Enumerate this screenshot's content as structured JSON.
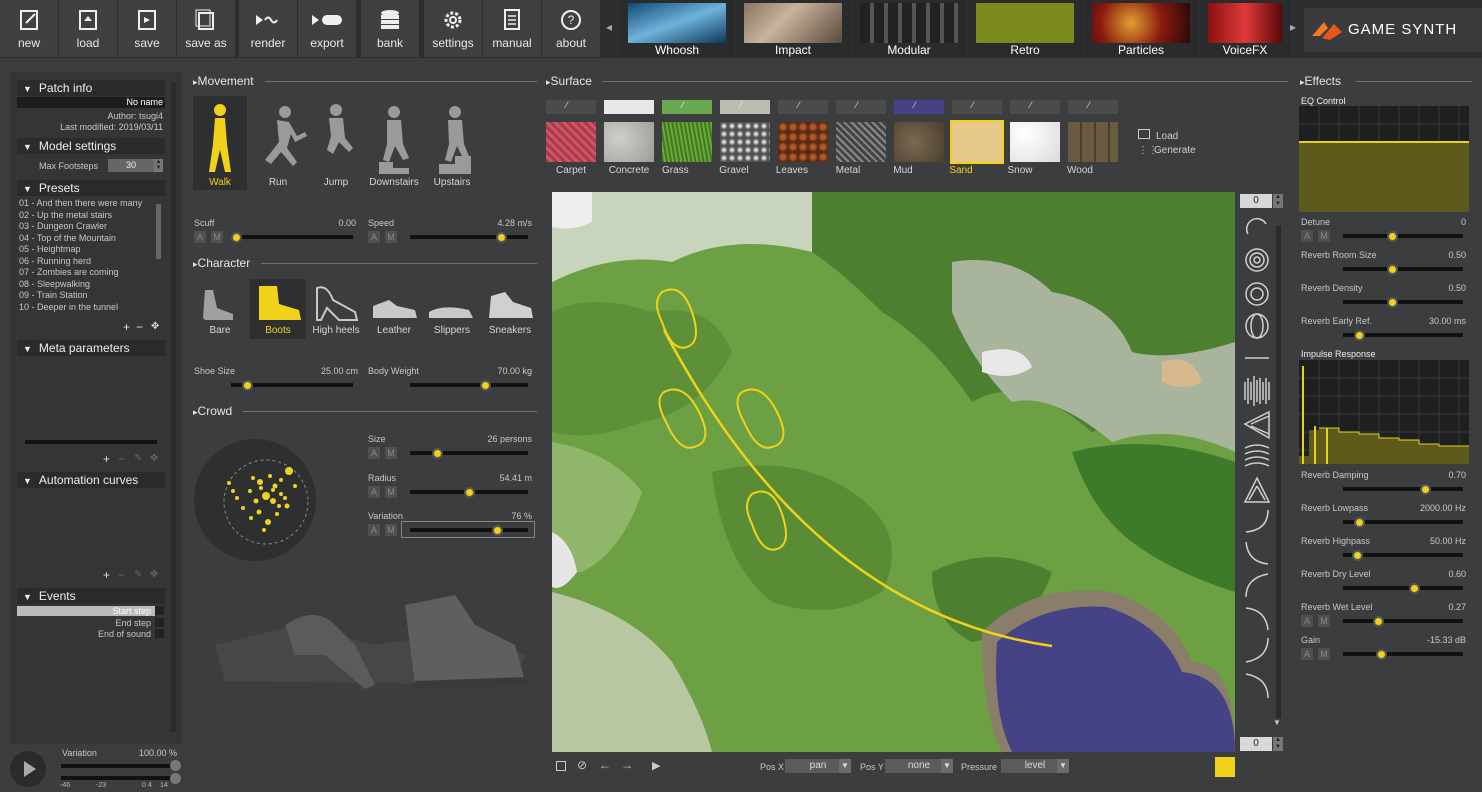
{
  "toolbar": {
    "buttons": [
      "new",
      "load",
      "save",
      "save as",
      "render",
      "export",
      "bank",
      "settings",
      "manual",
      "about"
    ],
    "library": [
      "Whoosh",
      "Impact",
      "Modular",
      "Retro",
      "Particles",
      "VoiceFX"
    ],
    "brand": "GAME SYNTH"
  },
  "left": {
    "patch_info": {
      "title": "Patch info",
      "name": "No name",
      "author": "Author: tsugi4",
      "modified": "Last modified: 2019/03/11"
    },
    "model_settings": {
      "title": "Model settings",
      "max_footsteps_label": "Max Footsteps",
      "max_footsteps_value": "30"
    },
    "presets": {
      "title": "Presets",
      "items": [
        "01 - And then there were many",
        "02 - Up the metal stairs",
        "03 - Dungeon Crawler",
        "04 - Top of the Mountain",
        "05 - Heightmap",
        "06 - Running herd",
        "07 - Zombies are coming",
        "08 - Sleepwalking",
        "09 - Train Station",
        "10 - Deeper in the tunnel"
      ]
    },
    "meta": {
      "title": "Meta parameters"
    },
    "automation": {
      "title": "Automation curves"
    },
    "events": {
      "title": "Events",
      "items": [
        "Start step",
        "End step",
        "End of sound"
      ]
    },
    "variation": {
      "label": "Variation",
      "value": "100.00",
      "unit": "%",
      "ticks": [
        "-46",
        "-23",
        "0",
        "4",
        "14"
      ]
    }
  },
  "movement": {
    "title": "Movement",
    "options": [
      "Walk",
      "Run",
      "Jump",
      "Downstairs",
      "Upstairs"
    ],
    "selected": "Walk",
    "scuff": {
      "label": "Scuff",
      "value": "0.00",
      "fraction": 0.0
    },
    "speed": {
      "label": "Speed",
      "value": "4.28 m/s",
      "fraction": 0.8
    }
  },
  "character": {
    "title": "Character",
    "options": [
      "Bare",
      "Boots",
      "High heels",
      "Leather",
      "Slippers",
      "Sneakers"
    ],
    "selected": "Boots",
    "shoe_size": {
      "label": "Shoe Size",
      "value": "25.00 cm",
      "fraction": 0.1
    },
    "body_weight": {
      "label": "Body Weight",
      "value": "70.00 kg",
      "fraction": 0.65
    }
  },
  "crowd": {
    "title": "Crowd",
    "size": {
      "label": "Size",
      "value": "26 persons",
      "fraction": 0.2
    },
    "radius": {
      "label": "Radius",
      "value": "54.41 m",
      "fraction": 0.5
    },
    "variation": {
      "label": "Variation",
      "value": "76 %",
      "fraction": 0.76
    }
  },
  "surface": {
    "title": "Surface",
    "materials": [
      "Carpet",
      "Concrete",
      "Grass",
      "Gravel",
      "Leaves",
      "Metal",
      "Mud",
      "Sand",
      "Snow",
      "Wood"
    ],
    "selected": "Sand",
    "actions": [
      "Load",
      "Generate"
    ],
    "top_counter": "0",
    "bottom_counter": "0",
    "posx_label": "Pos X",
    "posx_value": "pan",
    "posy_label": "Pos Y",
    "posy_value": "none",
    "pressure_label": "Pressure",
    "pressure_value": "level"
  },
  "effects": {
    "title": "Effects",
    "eq_label": "EQ Control",
    "impulse_label": "Impulse Response",
    "params": [
      {
        "label": "Detune",
        "value": "0",
        "fraction": 0.4
      },
      {
        "label": "Reverb Room Size",
        "value": "0.50",
        "fraction": 0.4
      },
      {
        "label": "Reverb Density",
        "value": "0.50",
        "fraction": 0.4
      },
      {
        "label": "Reverb Early Ref.",
        "value": "30.00 ms",
        "fraction": 0.1
      }
    ],
    "params2": [
      {
        "label": "Reverb Damping",
        "value": "0.70",
        "fraction": 0.7
      },
      {
        "label": "Reverb Lowpass",
        "value": "2000.00 Hz",
        "fraction": 0.1
      },
      {
        "label": "Reverb Highpass",
        "value": "50.00 Hz",
        "fraction": 0.08
      },
      {
        "label": "Reverb Dry Level",
        "value": "0.60",
        "fraction": 0.6
      },
      {
        "label": "Reverb Wet Level",
        "value": "0.27",
        "fraction": 0.27
      },
      {
        "label": "Gain",
        "value": "-15.33 dB",
        "fraction": 0.3
      }
    ]
  },
  "colors": {
    "accent": "#f1d21a",
    "water": "#454386",
    "grass": "#6d9f43"
  }
}
